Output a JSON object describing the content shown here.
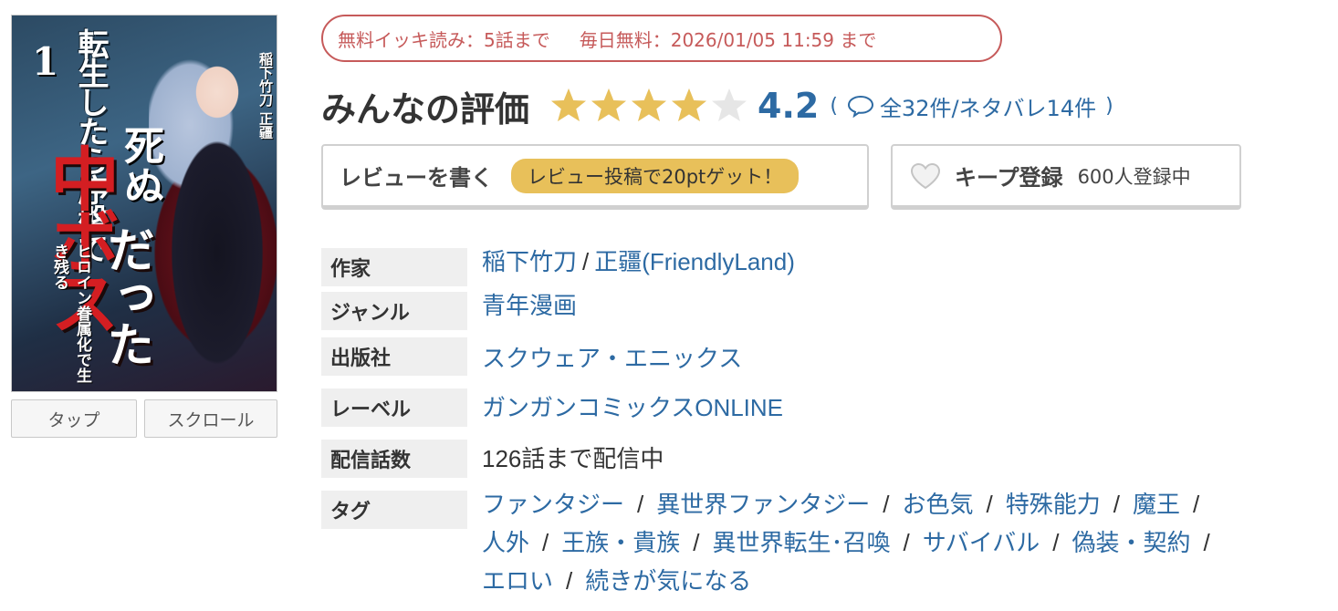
{
  "cover": {
    "volume": "1",
    "title_top": "転生したら序盤で",
    "title_mid": "死ぬ",
    "title_boss": "中ボス",
    "title_end": "だった",
    "subtitle": "ヒロイン眷属化で生き残る",
    "authors": "稲下竹刀 正疆"
  },
  "viewer_buttons": {
    "tap": "タップ",
    "scroll": "スクロール"
  },
  "free_banner": {
    "ikki": "無料イッキ読み：5話まで",
    "daily": "毎日無料：2026/01/05 11:59 まで"
  },
  "rating": {
    "title": "みんなの評価",
    "score": "4.2",
    "stars_value": 4.2,
    "stars_max": 5,
    "open_paren": "(",
    "close_paren": ")",
    "reviews_link": "全32件/ネタバレ14件",
    "icon": "speech-bubble-icon"
  },
  "actions": {
    "review_label": "レビューを書く",
    "review_badge": "レビュー投稿で20ptゲット！",
    "keep_label": "キープ登録",
    "keep_count": "600人登録中",
    "keep_icon": "heart-icon"
  },
  "info": {
    "author_label": "作家",
    "author_1": "稲下竹刀",
    "author_sep": "/",
    "author_2": "正疆(FriendlyLand)",
    "genre_label": "ジャンル",
    "genre": "青年漫画",
    "publisher_label": "出版社",
    "publisher": "スクウェア・エニックス",
    "label_label": "レーベル",
    "label": "ガンガンコミックスONLINE",
    "episodes_label": "配信話数",
    "episodes": "126話まで配信中",
    "tags_label": "タグ",
    "tags": [
      "ファンタジー",
      "異世界ファンタジー",
      "お色気",
      "特殊能力",
      "魔王",
      "人外",
      "王族・貴族",
      "異世界転生･召喚",
      "サバイバル",
      "偽装・契約",
      "エロい",
      "続きが気になる"
    ]
  },
  "colors": {
    "link": "#2d6aa3",
    "banner": "#c65a5a",
    "star_on": "#e8c05a",
    "star_off": "#e6e6e6",
    "badge": "#e8c05a"
  }
}
